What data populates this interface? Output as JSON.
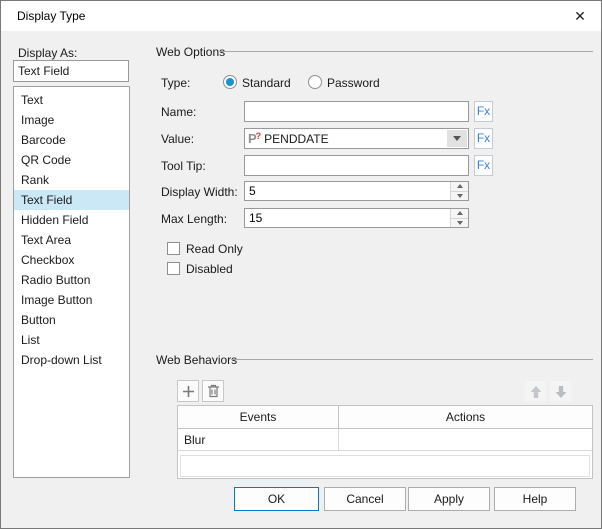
{
  "dialog": {
    "title": "Display Type"
  },
  "icons": {
    "close": "close-icon",
    "dropdown": "chevron-down-icon",
    "add": "plus-icon",
    "delete": "trash-icon",
    "move_up": "arrow-up-icon",
    "move_down": "arrow-down-icon",
    "parameter": "parameter-icon",
    "parameter_glyph_letter": "P",
    "parameter_glyph_mark": "?",
    "close_glyph": "✕"
  },
  "left_panel": {
    "label": "Display As:",
    "current_value": "Text Field",
    "selected_item": "Text Field",
    "items": [
      "Text",
      "Image",
      "Barcode",
      "QR Code",
      "Rank",
      "Text Field",
      "Hidden Field",
      "Text Area",
      "Checkbox",
      "Radio Button",
      "Image Button",
      "Button",
      "List",
      "Drop-down List"
    ]
  },
  "web_options": {
    "group_label": "Web Options",
    "type": {
      "label": "Type:",
      "options": [
        {
          "label": "Standard",
          "selected": true
        },
        {
          "label": "Password",
          "selected": false
        }
      ]
    },
    "name": {
      "label": "Name:",
      "value": "",
      "fx": "Fx"
    },
    "value": {
      "label": "Value:",
      "value": "PENDDATE",
      "fx": "Fx"
    },
    "tooltip": {
      "label": "Tool Tip:",
      "value": "",
      "fx": "Fx"
    },
    "display_width": {
      "label": "Display Width:",
      "value": "5"
    },
    "max_length": {
      "label": "Max Length:",
      "value": "15"
    },
    "checkboxes": [
      {
        "label": "Read Only",
        "checked": false
      },
      {
        "label": "Disabled",
        "checked": false
      }
    ]
  },
  "web_behaviors": {
    "group_label": "Web Behaviors",
    "table": {
      "columns": [
        "Events",
        "Actions"
      ],
      "rows": [
        {
          "event": "Blur",
          "action": ""
        }
      ]
    }
  },
  "footer": {
    "ok": "OK",
    "cancel": "Cancel",
    "apply": "Apply",
    "help": "Help"
  },
  "colors": {
    "accent": "#0078d7",
    "selection": "#cbe8f6",
    "fx_blue": "#3e7fd9",
    "radio_blue": "#1693d0",
    "dialog_bg": "#f0f0f0"
  }
}
